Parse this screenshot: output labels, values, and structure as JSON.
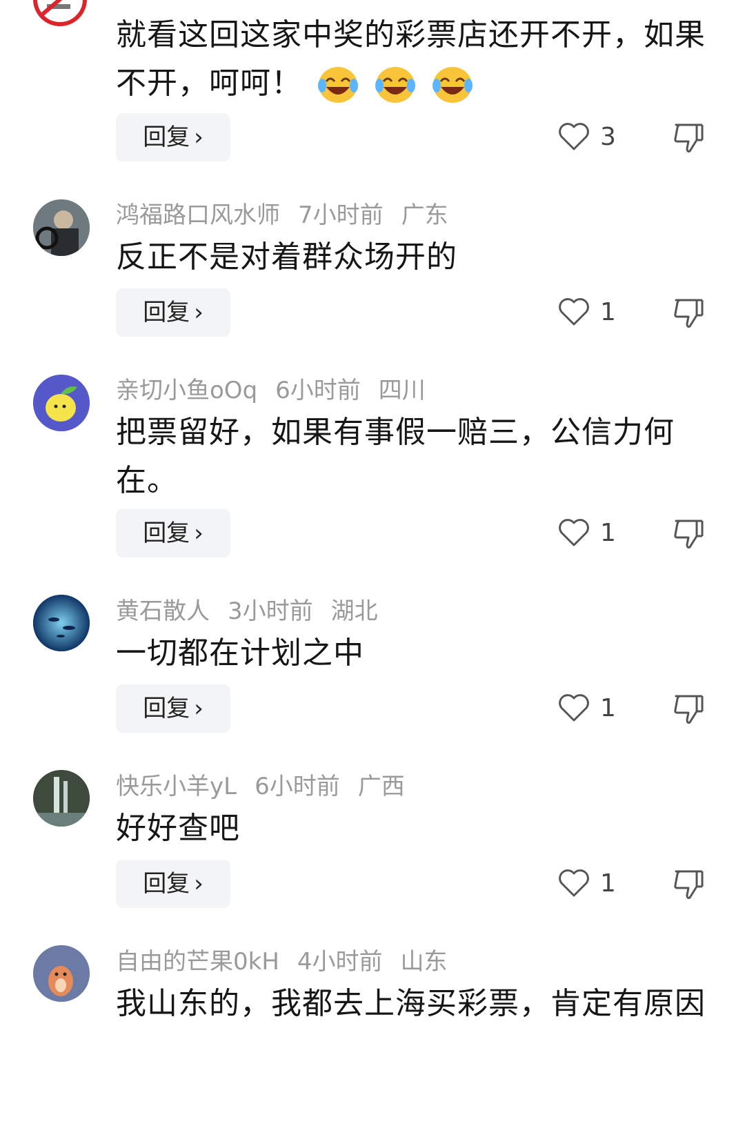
{
  "comments": [
    {
      "username": "",
      "time": "",
      "location": "",
      "text": "就看这回这家中奖的彩票店还开不开，如果不开，呵呵！",
      "emoji": [
        "laughing-crying-emoji",
        "laughing-crying-emoji",
        "laughing-crying-emoji"
      ],
      "reply_label": "回复",
      "likes": "3"
    },
    {
      "username": "鸿福路口风水师",
      "time": "7小时前",
      "location": "广东",
      "text": "反正不是对着群众场开的",
      "reply_label": "回复",
      "likes": "1"
    },
    {
      "username": "亲切小鱼oOq",
      "time": "6小时前",
      "location": "四川",
      "text": "把票留好，如果有事假一赔三，公信力何在。",
      "reply_label": "回复",
      "likes": "1"
    },
    {
      "username": "黄石散人",
      "time": "3小时前",
      "location": "湖北",
      "text": "一切都在计划之中",
      "reply_label": "回复",
      "likes": "1"
    },
    {
      "username": "快乐小羊yL",
      "time": "6小时前",
      "location": "广西",
      "text": "好好查吧",
      "reply_label": "回复",
      "likes": "1"
    },
    {
      "username": "自由的芒果0kH",
      "time": "4小时前",
      "location": "山东",
      "text": "我山东的，我都去上海买彩票，肯定有原因",
      "reply_label": "回复"
    }
  ],
  "icons": {
    "chevron": "chevron-right-icon",
    "like": "heart-outline-icon",
    "dislike": "thumbs-down-icon"
  },
  "colors": {
    "meta_text": "#9a9a9a",
    "reply_bg": "#f3f4f5"
  }
}
